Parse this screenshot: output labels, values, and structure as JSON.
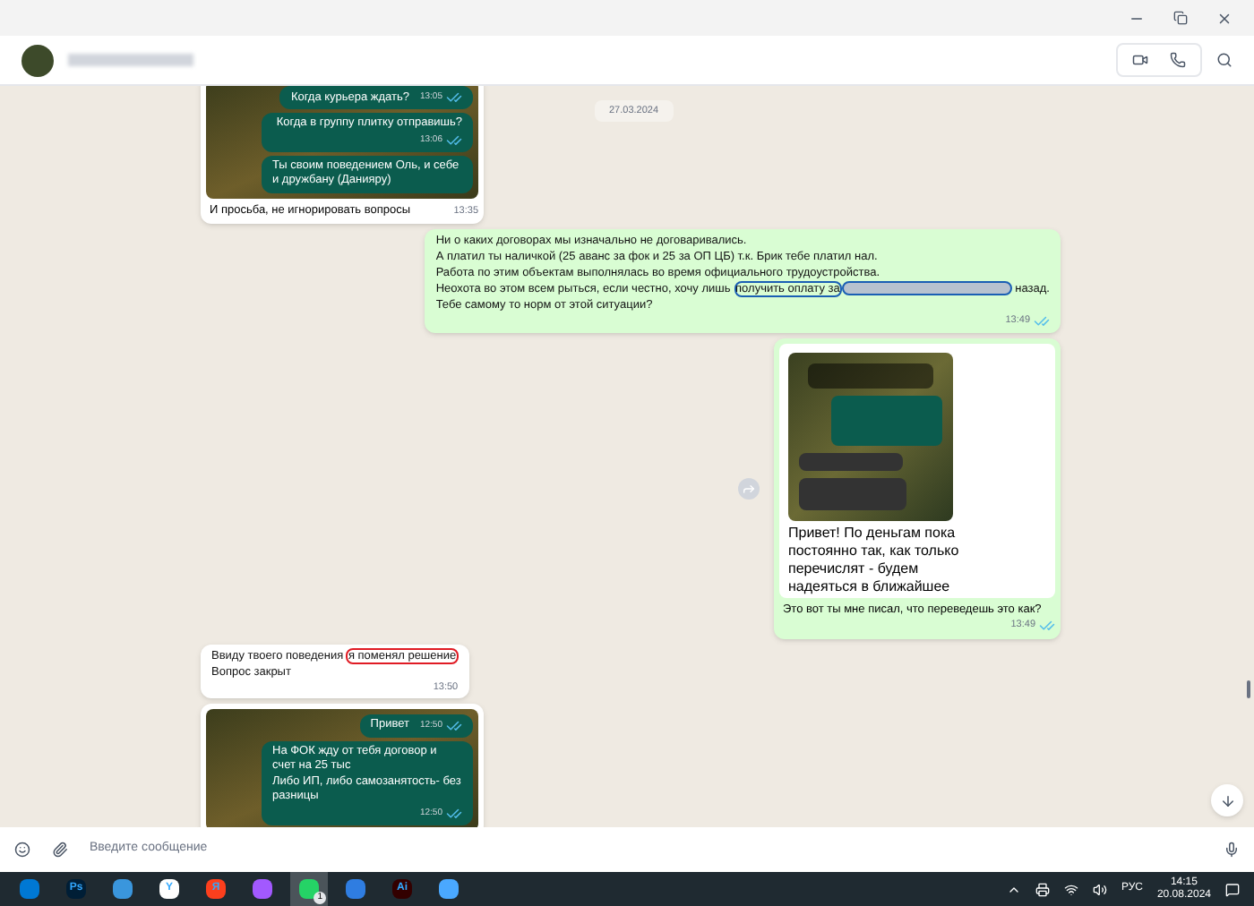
{
  "date_pill": "27.03.2024",
  "messages": [
    {
      "kind": "image",
      "outgoing": false,
      "shot": {
        "bubbles": [
          {
            "text": "Когда курьера ждать?",
            "time": "13:05",
            "read": true
          },
          {
            "text": "Когда в группу плитку отправишь?",
            "time": "13:06",
            "read": true
          },
          {
            "text": "Ты своим поведением Оль, и себе и дружбану (Данияру)"
          }
        ]
      },
      "caption": "И просьба, не игнорировать вопросы",
      "time": "13:35"
    },
    {
      "kind": "text",
      "outgoing": true,
      "segments": [
        {
          "kind": "text",
          "text": "Ни о каких договорах мы изначально не договаривались.\nА платил ты наличкой (25 аванс за фок и 25 за ОП ЦБ) т.к. Брик тебе платил нал.\nРабота по этим объектам выполнялась во время официального трудоустройства.\nНеохота во этом всем рыться, если честно, хочу лишь "
        },
        {
          "kind": "text",
          "text": "получить оплату за",
          "color": "#1a5fb4"
        },
        {
          "kind": "redacted",
          "color": "#1a5fb4"
        },
        {
          "kind": "text",
          "text": " назад.\nТебе самому то норм от этой ситуации?"
        }
      ],
      "time": "13:49",
      "read": true
    },
    {
      "kind": "doc",
      "outgoing": true,
      "shot_text": "Привет! По деньгам пока постоянно так, как только перечислят - будем надеяться в ближайшее",
      "caption": "Это вот ты мне писал, что переведешь это как?",
      "time": "13:49",
      "read": true
    },
    {
      "kind": "text",
      "outgoing": false,
      "segments": [
        {
          "kind": "text",
          "text": "Ввиду твоего поведения "
        },
        {
          "kind": "text",
          "text": "я поменял решение",
          "color": "#e01b24"
        },
        {
          "kind": "text",
          "text": "\nВопрос закрыт"
        }
      ],
      "time": "13:50"
    },
    {
      "kind": "image",
      "outgoing": false,
      "shot": {
        "bubbles": [
          {
            "text": "Привет",
            "time": "12:50",
            "read": true
          },
          {
            "text": "На ФОК жду от тебя договор и счет на 25 тыс\nЛибо ИП, либо самозанятость- без разницы",
            "time": "12:50",
            "read": true
          }
        ]
      }
    }
  ],
  "composer": {
    "placeholder": "Введите сообщение"
  },
  "taskbar": {
    "apps": [
      {
        "color": "#0078d4",
        "selected": false
      },
      {
        "label": "Ps",
        "color": "#001e36",
        "selected": false
      },
      {
        "color": "#3a96dd",
        "selected": false
      },
      {
        "label": "Y",
        "color": "#ffffff",
        "selected": false
      },
      {
        "label": "Я",
        "color": "#fc3f1d",
        "selected": false
      },
      {
        "color": "#a259ff",
        "selected": false
      },
      {
        "color": "#25d366",
        "selected": true,
        "badge": "1"
      },
      {
        "color": "#2f7de1",
        "selected": false
      },
      {
        "label": "Ai",
        "color": "#330000",
        "selected": false
      },
      {
        "color": "#4aa8ff",
        "selected": false
      }
    ],
    "lang": "РУС",
    "time": "14:15",
    "date": "20.08.2024"
  }
}
